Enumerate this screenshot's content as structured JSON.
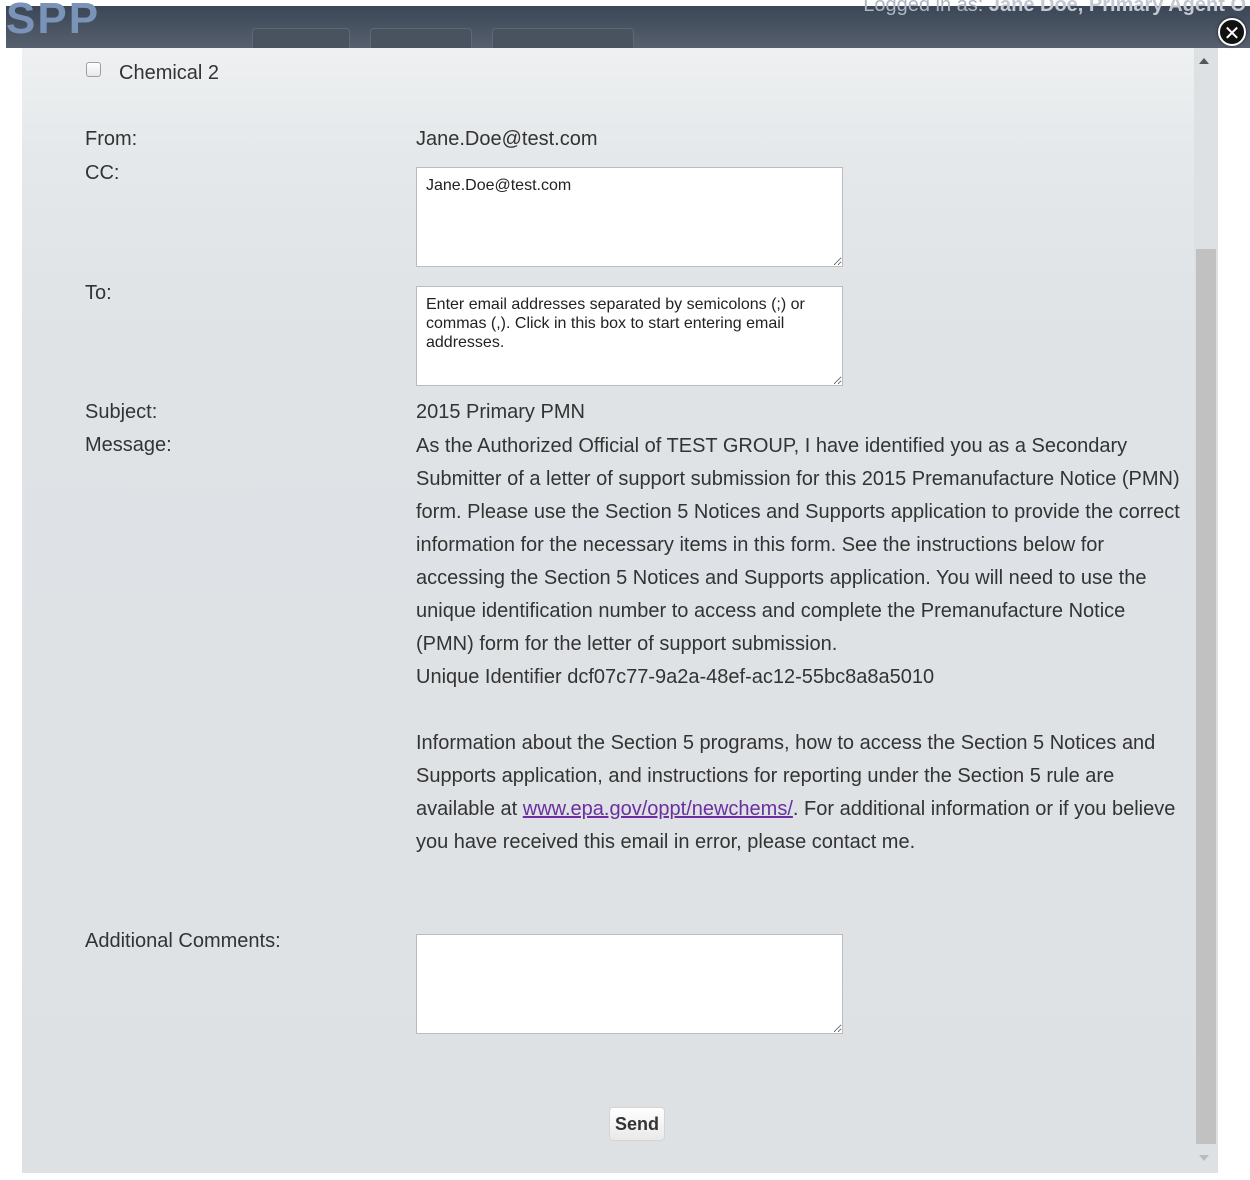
{
  "background": {
    "logo_text": "SPP",
    "logged_in_text": "Logged in as: ",
    "logged_in_user": "Jane Doe, Primary Agent O"
  },
  "modal": {
    "close_icon": "close-icon",
    "chemical_checkbox_label": "Chemical 2",
    "from_label": "From:",
    "from_value": "Jane.Doe@test.com",
    "cc_label": "CC:",
    "cc_value": "Jane.Doe@test.com",
    "to_label": "To:",
    "to_placeholder": "Enter email addresses separated by semicolons (;) or commas (,). Click in this box to start entering email addresses.",
    "subject_label": "Subject:",
    "subject_value": "2015 Primary PMN",
    "message_label": "Message:",
    "message_paragraph_1": "As the Authorized Official of TEST GROUP, I have identified you as a Secondary Submitter of a letter of support submission for this 2015 Premanufacture Notice (PMN) form. Please use the Section 5 Notices and Supports application to provide the correct information for the necessary items in this form. See the instructions below for accessing the Section 5 Notices and Supports application. You will need to use the unique identification number to access and complete the Premanufacture Notice (PMN) form for the letter of support submission.",
    "unique_identifier_line": "Unique Identifier dcf07c77-9a2a-48ef-ac12-55bc8a8a5010",
    "message_paragraph_2_before_link": "Information about the Section 5 programs, how to access the Section 5 Notices and Supports application, and instructions for reporting under the Section 5 rule are available at ",
    "message_link_text": "www.epa.gov/oppt/newchems/",
    "message_paragraph_2_after_link": ". For additional information or if you believe you have received this email in error, please contact me.",
    "additional_comments_label": "Additional Comments:",
    "additional_comments_value": "",
    "send_label": "Send"
  },
  "colors": {
    "link": "#6b2fa0",
    "header": "#3b4656"
  }
}
